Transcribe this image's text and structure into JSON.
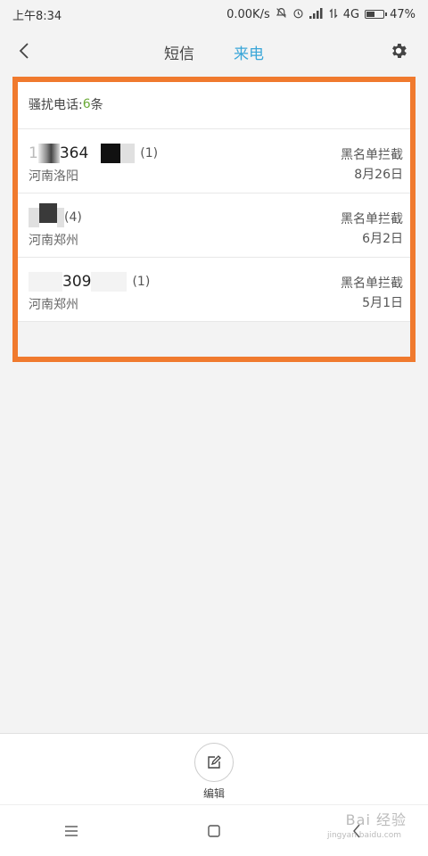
{
  "status_bar": {
    "time": "上午8:34",
    "speed": "0.00K/s",
    "network": "4G",
    "battery": "47%",
    "battery_level": 0.47
  },
  "header": {
    "tabs": [
      {
        "label": "短信",
        "active": false
      },
      {
        "label": "来电",
        "active": true
      }
    ],
    "accent_color": "#3aa6d8"
  },
  "summary": {
    "label": "骚扰电话:",
    "count": "6",
    "unit": "条"
  },
  "calls": [
    {
      "number_prefix": "1",
      "number_mid": "364",
      "count": "(1)",
      "location": "河南洛阳",
      "reason": "黑名单拦截",
      "date": "8月26日"
    },
    {
      "number_prefix": "",
      "number_mid": "",
      "count": "(4)",
      "location": "河南郑州",
      "reason": "黑名单拦截",
      "date": "6月2日"
    },
    {
      "number_prefix": "",
      "number_mid": "309",
      "count": "(1)",
      "location": "河南郑州",
      "reason": "黑名单拦截",
      "date": "5月1日"
    }
  ],
  "bottom": {
    "edit_label": "编辑"
  },
  "watermark": {
    "text": "Bai 经验",
    "sub": "jingyan.baidu.com"
  },
  "colors": {
    "highlight": "#f07a2e",
    "count_green": "#6aaa36"
  }
}
